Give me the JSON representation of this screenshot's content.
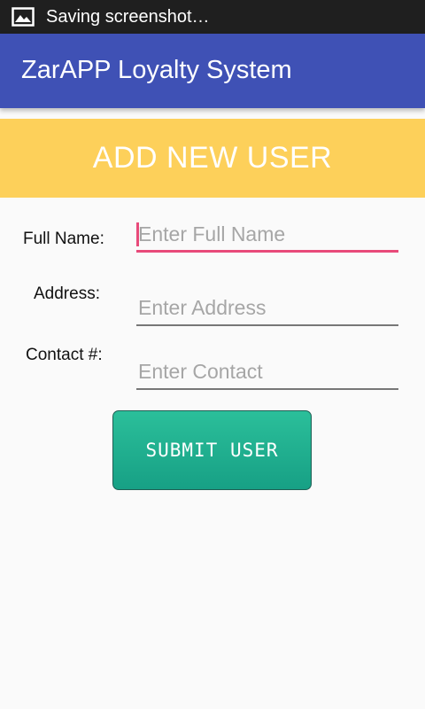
{
  "status_bar": {
    "icon": "image-icon",
    "text": "Saving screenshot…"
  },
  "app_bar": {
    "title": "ZarAPP Loyalty System",
    "color": "#3f51b5"
  },
  "banner": {
    "title": "ADD NEW USER",
    "color": "#fdd05a"
  },
  "form": {
    "full_name": {
      "label": "Full Name:",
      "placeholder": "Enter Full Name"
    },
    "address": {
      "label": "Address:",
      "placeholder": "Enter Address"
    },
    "contact": {
      "label": "Contact #:",
      "placeholder": "Enter Contact"
    },
    "accent_color": "#e84a7a"
  },
  "submit": {
    "label": "SUBMIT USER",
    "color": "#1fab8d"
  }
}
